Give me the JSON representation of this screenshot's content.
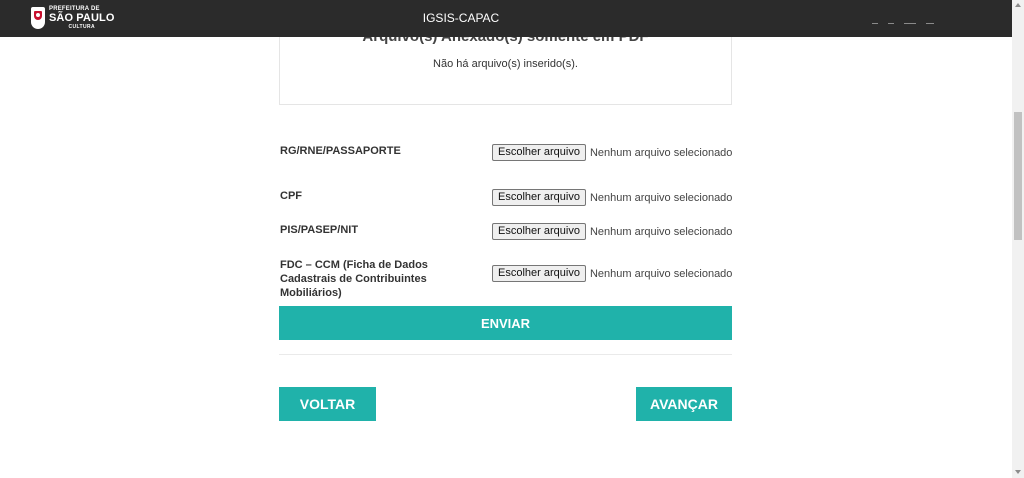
{
  "navbar": {
    "logo": {
      "line1": "PREFEITURA DE",
      "line2": "SÃO PAULO",
      "line3": "CULTURA"
    },
    "title": "IGSIS-CAPAC"
  },
  "files_panel": {
    "heading": "Arquivo(s) Anexado(s) somente em PDF",
    "empty_message": "Não há arquivo(s) inserido(s)."
  },
  "upload_rows": [
    {
      "label": "RG/RNE/PASSAPORTE",
      "button": "Escolher arquivo",
      "status": "Nenhum arquivo selecionado"
    },
    {
      "label": "CPF",
      "button": "Escolher arquivo",
      "status": "Nenhum arquivo selecionado"
    },
    {
      "label": "PIS/PASEP/NIT",
      "button": "Escolher arquivo",
      "status": "Nenhum arquivo selecionado"
    },
    {
      "label": "FDC – CCM (Ficha de Dados Cadastrais de Contribuintes Mobiliários)",
      "button": "Escolher arquivo",
      "status": "Nenhum arquivo selecionado"
    }
  ],
  "actions": {
    "submit": "ENVIAR",
    "back": "VOLTAR",
    "next": "AVANÇAR"
  },
  "colors": {
    "navbar_bg": "#2b2b2b",
    "accent": "#20b2aa"
  }
}
